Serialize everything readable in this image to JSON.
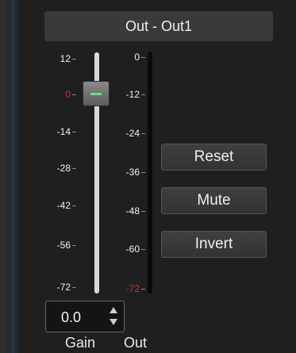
{
  "title": "Out - Out1",
  "gain_scale": [
    {
      "label": "12"
    },
    {
      "label": "0",
      "color": "#e03030"
    },
    {
      "label": "-14"
    },
    {
      "label": "-28"
    },
    {
      "label": "-42"
    },
    {
      "label": "-56"
    },
    {
      "label": "-72"
    }
  ],
  "out_scale": [
    {
      "label": "0"
    },
    {
      "label": "-12"
    },
    {
      "label": "-24"
    },
    {
      "label": "-36"
    },
    {
      "label": "-48"
    },
    {
      "label": "-60"
    },
    {
      "label": "-72",
      "color": "#e03030"
    }
  ],
  "buttons": {
    "reset": "Reset",
    "mute": "Mute",
    "invert": "Invert"
  },
  "gain": {
    "value": "0.0"
  },
  "labels": {
    "gain": "Gain",
    "out": "Out"
  },
  "colors": {
    "zero_marker": "#e03030",
    "fader_grip": "#66e08a"
  },
  "icons": {
    "spin_up": "chevron-up-icon",
    "spin_down": "chevron-down-icon"
  }
}
